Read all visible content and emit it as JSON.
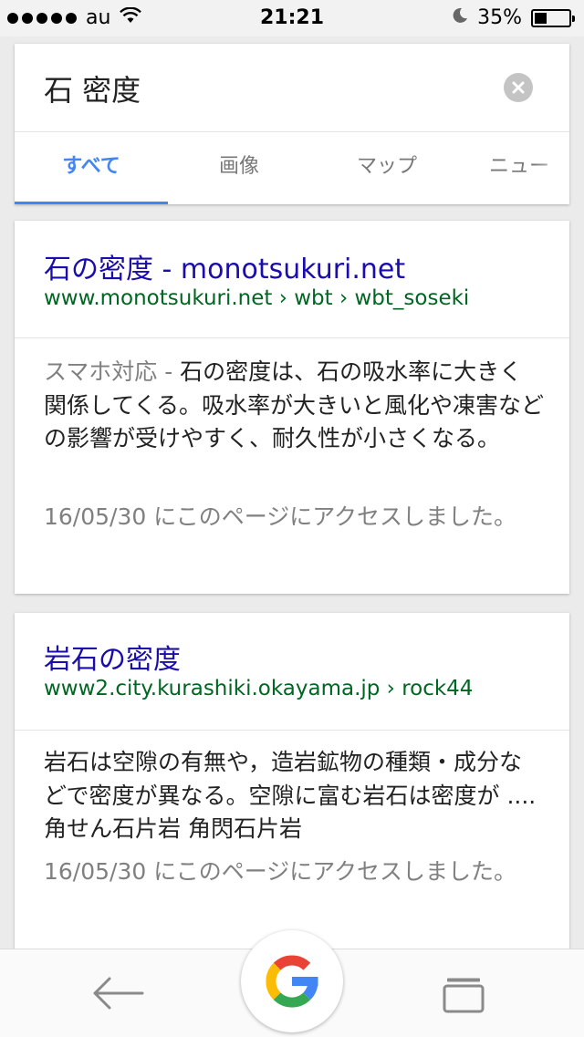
{
  "status_bar": {
    "carrier": "au",
    "time": "21:21",
    "battery": "35%",
    "battery_level": 0.35
  },
  "search": {
    "query": "石 密度"
  },
  "tabs": [
    {
      "label": "すべて",
      "active": true
    },
    {
      "label": "画像"
    },
    {
      "label": "マップ"
    },
    {
      "label": "ニュー"
    }
  ],
  "results": [
    {
      "title": "石の密度 - monotsukuri.net",
      "url": "www.monotsukuri.net › wbt › wbt_soseki",
      "snippet_prefix": "スマホ対応 - ",
      "snippet": "石の密度は、石の吸水率に大きく関係してくる。吸水率が大きいと風化や凍害などの影響が受けやすく、耐久性が小さくなる。",
      "date": "16/05/30 にこのページにアクセスしました。"
    },
    {
      "title": "岩石の密度",
      "url": "www2.city.kurashiki.okayama.jp › rock44",
      "snippet_prefix": "",
      "snippet": "岩石は空隙の有無や，造岩鉱物の種類・成分などで密度が異なる。空隙に富む岩石は密度が .... 角せん石片岩 角閃石片岩",
      "date": "16/05/30 にこのページにアクセスしました。"
    }
  ],
  "colors": {
    "link": "#1a0dab",
    "url": "#006621",
    "accent": "#4285f4"
  }
}
